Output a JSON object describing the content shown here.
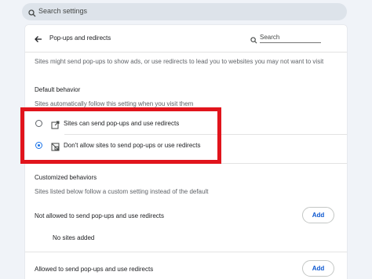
{
  "top_search": {
    "placeholder": "Search settings"
  },
  "page": {
    "title": "Pop-ups and redirects",
    "search_label": "Search",
    "description": "Sites might send pop-ups to show ads, or use redirects to lead you to websites you may not want to visit"
  },
  "default_behavior": {
    "heading": "Default behavior",
    "subtitle": "Sites automatically follow this setting when you visit them",
    "options": [
      {
        "label": "Sites can send pop-ups and use redirects",
        "icon": "open-in-new-icon",
        "selected": false
      },
      {
        "label": "Don't allow sites to send pop-ups or use redirects",
        "icon": "popup-blocked-icon",
        "selected": true
      }
    ]
  },
  "customized": {
    "heading": "Customized behaviors",
    "subtitle": "Sites listed below follow a custom setting instead of the default",
    "not_allowed": {
      "label": "Not allowed to send pop-ups and use redirects",
      "add_label": "Add",
      "empty": "No sites added"
    },
    "allowed": {
      "label": "Allowed to send pop-ups and use redirects",
      "add_label": "Add"
    }
  },
  "colors": {
    "accent": "#1a73e8",
    "highlight": "#e1141c",
    "add_text": "#0b57d0"
  }
}
